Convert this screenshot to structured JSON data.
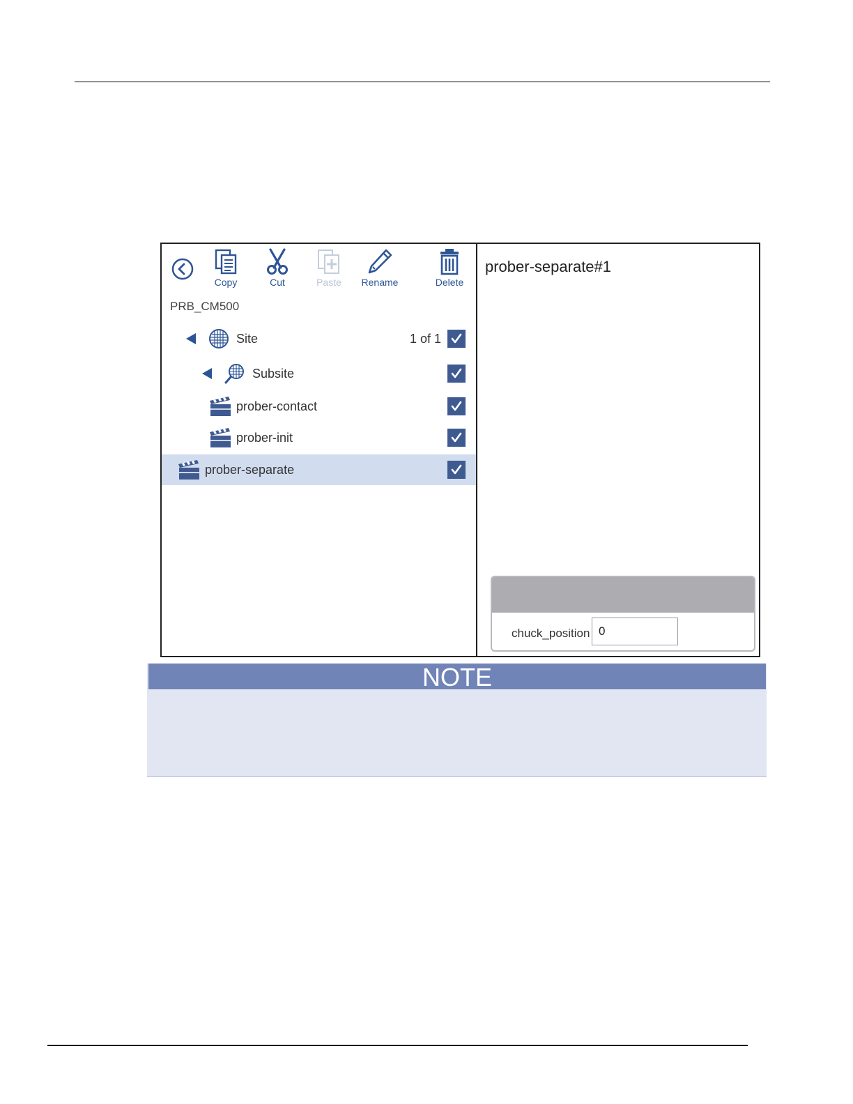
{
  "toolbar": {
    "copy_label": "Copy",
    "cut_label": "Cut",
    "paste_label": "Paste",
    "rename_label": "Rename",
    "delete_label": "Delete",
    "back_icon": "back-circle-icon"
  },
  "tree": {
    "root_label": "PRB_CM500",
    "items": [
      {
        "label": "Site",
        "count": "1 of 1",
        "icon": "wafer-icon",
        "expanded": true,
        "checked": true,
        "selected": false
      },
      {
        "label": "Subsite",
        "icon": "subsite-icon",
        "expanded": true,
        "checked": true,
        "selected": false
      },
      {
        "label": "prober-contact",
        "icon": "clapperboard-icon",
        "checked": true,
        "selected": false
      },
      {
        "label": "prober-init",
        "icon": "clapperboard-icon",
        "checked": true,
        "selected": false
      },
      {
        "label": "prober-separate",
        "icon": "clapperboard-icon",
        "checked": true,
        "selected": true
      }
    ]
  },
  "detail": {
    "title": "prober-separate#1",
    "param_label": "chuck_position",
    "param_value": "0"
  },
  "note": {
    "heading": "NOTE"
  },
  "colors": {
    "accent": "#2d5596",
    "checkbox": "#3e5a91",
    "selected_row": "#d1ddee",
    "note_header": "#7184b8",
    "note_body": "#e1e6f2"
  }
}
